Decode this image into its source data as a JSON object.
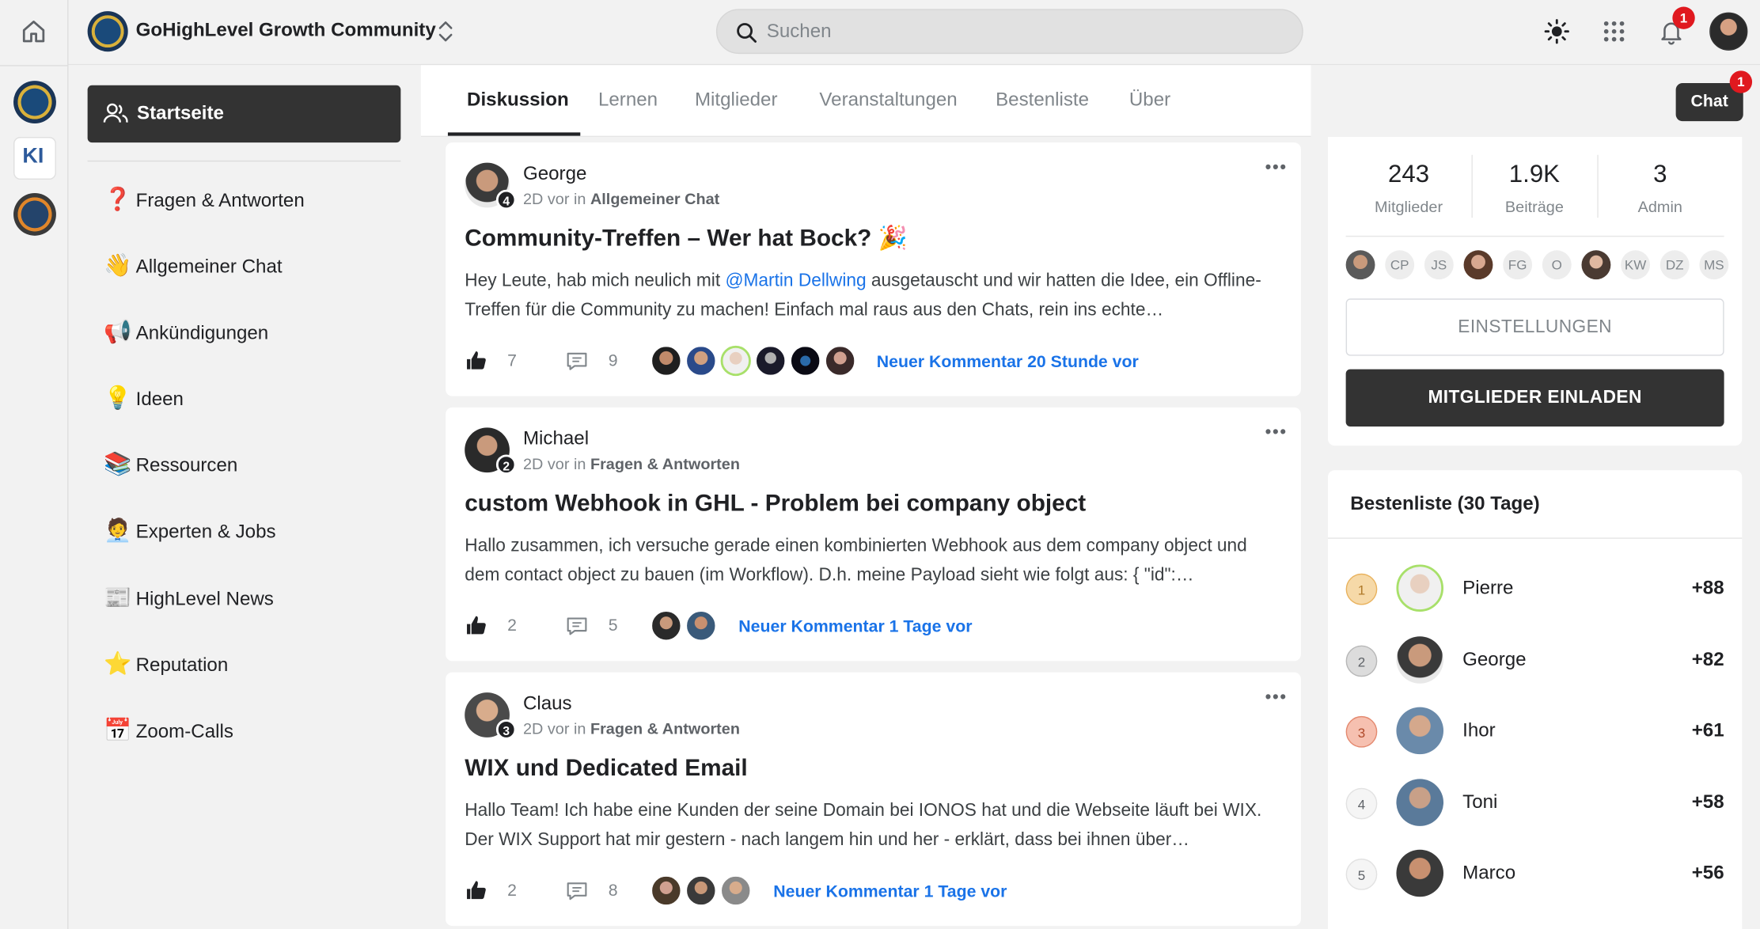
{
  "topbar": {
    "community_name": "GoHighLevel Growth Community",
    "search_placeholder": "Suchen",
    "notification_count": "1"
  },
  "rail": {
    "ki_label": "KI"
  },
  "sidebar": {
    "active": "Startseite",
    "items": [
      {
        "emoji": "❓",
        "label": "Fragen & Antworten"
      },
      {
        "emoji": "👋",
        "label": "Allgemeiner Chat"
      },
      {
        "emoji": "📢",
        "label": "Ankündigungen"
      },
      {
        "emoji": "💡",
        "label": "Ideen"
      },
      {
        "emoji": "📚",
        "label": "Ressourcen"
      },
      {
        "emoji": "🧑‍💼",
        "label": "Experten & Jobs"
      },
      {
        "emoji": "📰",
        "label": "HighLevel News"
      },
      {
        "emoji": "⭐",
        "label": "Reputation"
      },
      {
        "emoji": "📅",
        "label": "Zoom-Calls"
      }
    ]
  },
  "tabs": [
    "Diskussion",
    "Lernen",
    "Mitglieder",
    "Veranstaltungen",
    "Bestenliste",
    "Über"
  ],
  "posts": [
    {
      "author": "George",
      "level": "4",
      "time": "2D vor in",
      "category": "Allgemeiner Chat",
      "title": "Community-Treffen – Wer hat Bock? 🎉",
      "body_prefix": "Hey Leute, hab mich neulich mit ",
      "body_mention": "@Martin Dellwing",
      "body_suffix": " ausgetauscht und wir hatten die Idee, ein Offline-Treffen für die Community zu machen! Einfach mal raus aus den Chats, rein ins echte…",
      "likes": "7",
      "comments": "9",
      "new_comment": "Neuer Kommentar 20 Stunde vor"
    },
    {
      "author": "Michael",
      "level": "2",
      "time": "2D vor in",
      "category": "Fragen & Antworten",
      "title": "custom Webhook in GHL - Problem bei company object",
      "body_prefix": "Hallo zusammen, ich versuche gerade einen kombinierten Webhook aus dem company object und dem contact object zu bauen (im Workflow). D.h. meine Payload sieht wie folgt aus: { \"id\":…",
      "body_mention": "",
      "body_suffix": "",
      "likes": "2",
      "comments": "5",
      "new_comment": "Neuer Kommentar 1 Tage vor"
    },
    {
      "author": "Claus",
      "level": "3",
      "time": "2D vor in",
      "category": "Fragen & Antworten",
      "title": "WIX und Dedicated Email",
      "body_prefix": "Hallo Team! Ich habe eine Kunden der seine Domain bei IONOS hat und die Webseite läuft bei WIX. Der WIX Support hat mir gestern - nach langem hin und her - erklärt, dass bei ihnen über…",
      "body_mention": "",
      "body_suffix": "",
      "likes": "2",
      "comments": "8",
      "new_comment": "Neuer Kommentar 1 Tage vor"
    }
  ],
  "chat": {
    "label": "Chat",
    "badge": "1"
  },
  "stats": [
    {
      "value": "243",
      "label": "Mitglieder"
    },
    {
      "value": "1.9K",
      "label": "Beiträge"
    },
    {
      "value": "3",
      "label": "Admin"
    }
  ],
  "member_initials": [
    "",
    "CP",
    "JS",
    "",
    "FG",
    "O",
    "",
    "KW",
    "DZ",
    "MS"
  ],
  "buttons": {
    "settings": "EINSTELLUNGEN",
    "invite": "MITGLIEDER EINLADEN"
  },
  "leaderboard": {
    "title": "Bestenliste (30 Tage)",
    "rows": [
      {
        "rank": "1",
        "name": "Pierre",
        "points": "+88"
      },
      {
        "rank": "2",
        "name": "George",
        "points": "+82"
      },
      {
        "rank": "3",
        "name": "Ihor",
        "points": "+61"
      },
      {
        "rank": "4",
        "name": "Toni",
        "points": "+58"
      },
      {
        "rank": "5",
        "name": "Marco",
        "points": "+56"
      }
    ]
  },
  "colors": {
    "accent_blue": "#1a73e8",
    "dark_button": "#333333",
    "badge_red": "#e0191f"
  }
}
